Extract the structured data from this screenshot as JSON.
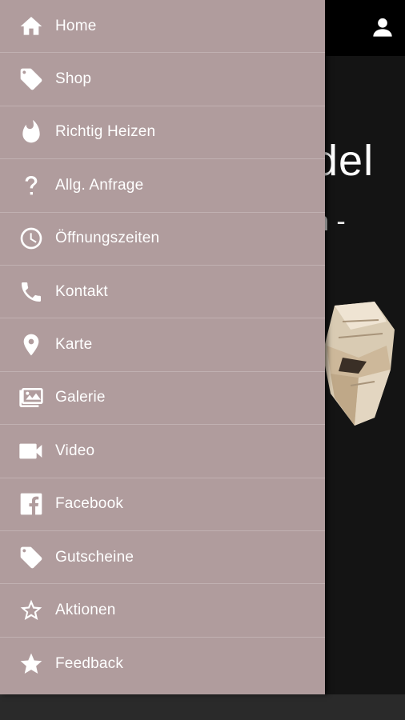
{
  "background": {
    "title": "del",
    "subtitle": "n -"
  },
  "menu": {
    "items": [
      {
        "label": "Home",
        "icon": "home-icon"
      },
      {
        "label": "Shop",
        "icon": "tag-icon"
      },
      {
        "label": "Richtig Heizen",
        "icon": "flame-icon"
      },
      {
        "label": "Allg. Anfrage",
        "icon": "question-icon"
      },
      {
        "label": "Öffnungszeiten",
        "icon": "clock-icon"
      },
      {
        "label": "Kontakt",
        "icon": "phone-icon"
      },
      {
        "label": "Karte",
        "icon": "map-pin-icon"
      },
      {
        "label": "Galerie",
        "icon": "gallery-icon"
      },
      {
        "label": "Video",
        "icon": "video-icon"
      },
      {
        "label": "Facebook",
        "icon": "facebook-icon"
      },
      {
        "label": "Gutscheine",
        "icon": "tag-icon"
      },
      {
        "label": "Aktionen",
        "icon": "star-outline-icon"
      },
      {
        "label": "Feedback",
        "icon": "star-icon"
      }
    ]
  },
  "colors": {
    "drawer": "#b09c9d",
    "header": "#000000",
    "content": "#141414"
  }
}
